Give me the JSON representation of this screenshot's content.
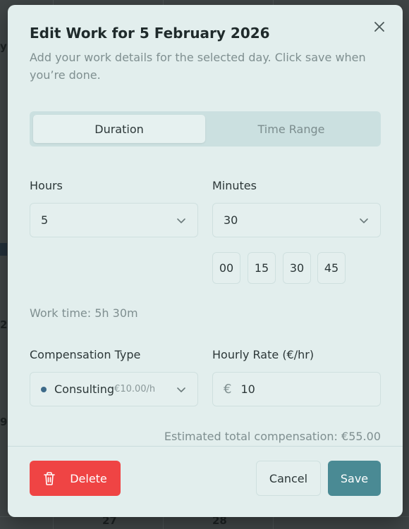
{
  "modal": {
    "title": "Edit Work for 5 February 2026",
    "description": "Add your work details for the selected day. Click save when you’re done."
  },
  "tabs": [
    {
      "label": "Duration",
      "active": true
    },
    {
      "label": "Time Range",
      "active": false
    }
  ],
  "hours": {
    "label": "Hours",
    "value": "5"
  },
  "minutes": {
    "label": "Minutes",
    "value": "30",
    "quick": [
      "00",
      "15",
      "30",
      "45"
    ]
  },
  "work_time": "Work time: 5h 30m",
  "compensation": {
    "label": "Compensation Type",
    "value": "Consulting",
    "rate_hint": "€10.00/h",
    "dot_color": "#3d6a89"
  },
  "hourly_rate": {
    "label": "Hourly Rate (€/hr)",
    "currency": "€",
    "value": "10"
  },
  "estimate": "Estimated total compensation: €55.00",
  "buttons": {
    "delete": "Delete",
    "cancel": "Cancel",
    "save": "Save"
  },
  "background": {
    "day_numbers": [
      "27",
      "28"
    ],
    "edge_glyphs": [
      "y",
      "2",
      "9"
    ]
  },
  "colors": {
    "accent": "#4a8a94",
    "danger": "#ef4444"
  }
}
